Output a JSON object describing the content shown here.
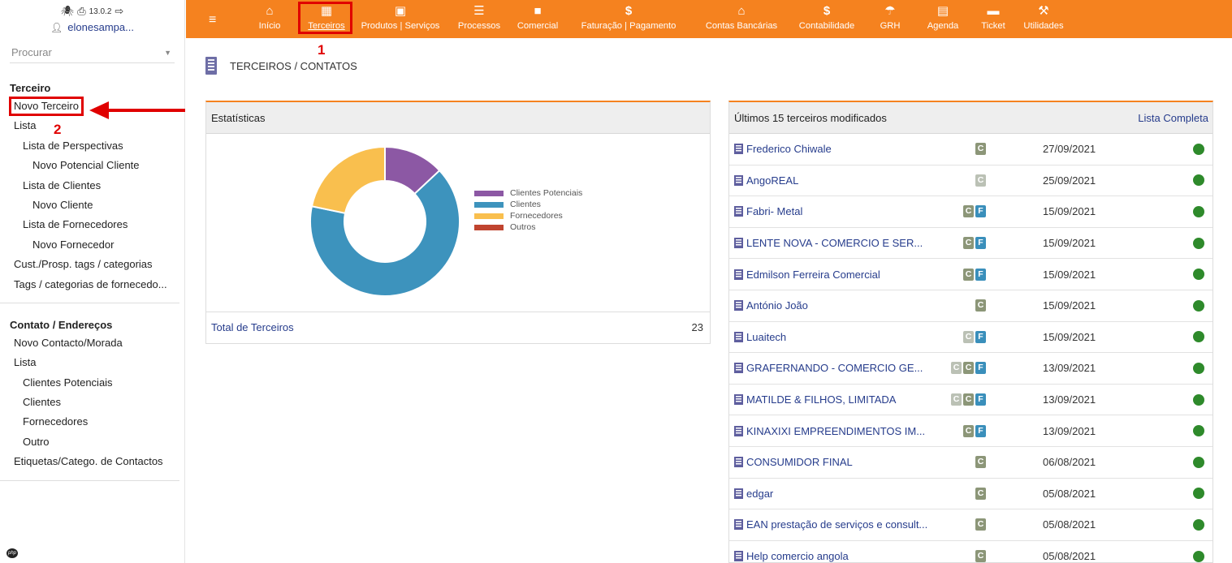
{
  "app": {
    "version": "13.0.2",
    "username": "elonesampa..."
  },
  "sidebar": {
    "search_placeholder": "Procurar",
    "section1": {
      "title": "Terceiro",
      "items": [
        {
          "label": "Novo Terceiro"
        },
        {
          "label": "Lista"
        },
        {
          "label": "Lista de Perspectivas"
        },
        {
          "label": "Novo Potencial Cliente"
        },
        {
          "label": "Lista de Clientes"
        },
        {
          "label": "Novo Cliente"
        },
        {
          "label": "Lista de Fornecedores"
        },
        {
          "label": "Novo Fornecedor"
        },
        {
          "label": "Cust./Prosp. tags / categorias"
        },
        {
          "label": "Tags / categorias de fornecedo..."
        }
      ]
    },
    "section2": {
      "title": "Contato / Endereços",
      "items": [
        {
          "label": "Novo Contacto/Morada"
        },
        {
          "label": "Lista"
        },
        {
          "label": "Clientes Potenciais"
        },
        {
          "label": "Clientes"
        },
        {
          "label": "Fornecedores"
        },
        {
          "label": "Outro"
        },
        {
          "label": "Etiquetas/Catego. de Contactos"
        }
      ]
    }
  },
  "topmenu": {
    "items": [
      {
        "label": "Início",
        "icon": "home-icon"
      },
      {
        "label": "Terceiros",
        "icon": "building-icon"
      },
      {
        "label": "Produtos | Serviços",
        "icon": "product-icon"
      },
      {
        "label": "Processos",
        "icon": "clipboard-icon"
      },
      {
        "label": "Comercial",
        "icon": "briefcase-icon"
      },
      {
        "label": "Faturação | Pagamento",
        "icon": "dollar-icon"
      },
      {
        "label": "Contas Bancárias",
        "icon": "bank-icon"
      },
      {
        "label": "Contabilidade",
        "icon": "dollar-icon"
      },
      {
        "label": "GRH",
        "icon": "umbrella-icon"
      },
      {
        "label": "Agenda",
        "icon": "calendar-icon"
      },
      {
        "label": "Ticket",
        "icon": "ticket-icon"
      },
      {
        "label": "Utilidades",
        "icon": "wrench-icon"
      }
    ],
    "accent": "#f5821f"
  },
  "annotations": {
    "one": "1",
    "two": "2"
  },
  "page": {
    "title": "TERCEIROS / CONTATOS"
  },
  "stats": {
    "title": "Estatísticas",
    "total_label": "Total de Terceiros",
    "total_value": "23"
  },
  "chart_data": {
    "type": "pie",
    "categories": [
      "Clientes Potenciais",
      "Clientes",
      "Fornecedores",
      "Outros"
    ],
    "values": [
      3,
      15,
      5,
      0
    ],
    "colors": [
      "#8c58a4",
      "#3d93bd",
      "#f9bf4e",
      "#c0442f"
    ],
    "legend": "right"
  },
  "latest": {
    "title": "Últimos 15 terceiros modificados",
    "full_list_label": "Lista Completa",
    "rows": [
      {
        "name": "Frederico Chiwale",
        "badges": [
          "C"
        ],
        "date": "27/09/2021"
      },
      {
        "name": "AngoREAL",
        "badges": [
          "P"
        ],
        "date": "25/09/2021"
      },
      {
        "name": "Fabri- Metal",
        "badges": [
          "C",
          "F"
        ],
        "date": "15/09/2021"
      },
      {
        "name": "LENTE NOVA - COMERCIO E SER...",
        "badges": [
          "C",
          "F"
        ],
        "date": "15/09/2021"
      },
      {
        "name": "Edmilson Ferreira Comercial",
        "badges": [
          "C",
          "F"
        ],
        "date": "15/09/2021"
      },
      {
        "name": "António João",
        "badges": [
          "C"
        ],
        "date": "15/09/2021"
      },
      {
        "name": "Luaitech",
        "badges": [
          "P",
          "F"
        ],
        "date": "15/09/2021"
      },
      {
        "name": "GRAFERNANDO - COMERCIO GE...",
        "badges": [
          "P",
          "C",
          "F"
        ],
        "date": "13/09/2021"
      },
      {
        "name": "MATILDE & FILHOS, LIMITADA",
        "badges": [
          "P",
          "C",
          "F"
        ],
        "date": "13/09/2021"
      },
      {
        "name": "KINAXIXI EMPREENDIMENTOS IM...",
        "badges": [
          "C",
          "F"
        ],
        "date": "13/09/2021"
      },
      {
        "name": "CONSUMIDOR FINAL",
        "badges": [
          "C"
        ],
        "date": "06/08/2021"
      },
      {
        "name": "edgar",
        "badges": [
          "C"
        ],
        "date": "05/08/2021"
      },
      {
        "name": "EAN prestação de serviços e consult...",
        "badges": [
          "C"
        ],
        "date": "05/08/2021"
      },
      {
        "name": "Help comercio angola",
        "badges": [
          "C"
        ],
        "date": "05/08/2021"
      }
    ]
  }
}
